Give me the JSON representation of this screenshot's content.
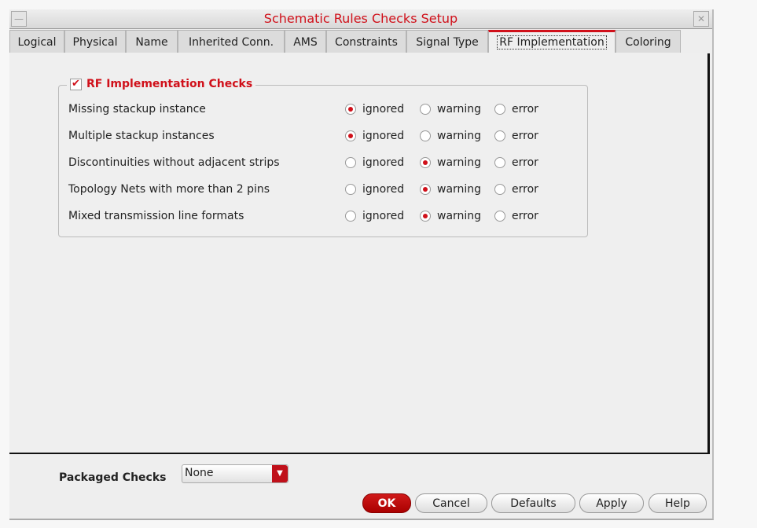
{
  "window": {
    "title": "Schematic Rules Checks Setup",
    "minimize_icon": "minimize-icon",
    "close_icon": "close-icon"
  },
  "tabs": [
    {
      "label": "Logical"
    },
    {
      "label": "Physical"
    },
    {
      "label": "Name"
    },
    {
      "label": "Inherited Conn."
    },
    {
      "label": "AMS"
    },
    {
      "label": "Constraints"
    },
    {
      "label": "Signal Type"
    },
    {
      "label": "RF Implementation",
      "active": true
    },
    {
      "label": "Coloring"
    }
  ],
  "group": {
    "label": "RF Implementation Checks",
    "checked": true
  },
  "options": [
    "ignored",
    "warning",
    "error"
  ],
  "checks": [
    {
      "label": "Missing stackup instance",
      "value": "ignored"
    },
    {
      "label": "Multiple stackup instances",
      "value": "ignored"
    },
    {
      "label": "Discontinuities without adjacent strips",
      "value": "warning"
    },
    {
      "label": "Topology Nets with more than 2 pins",
      "value": "warning"
    },
    {
      "label": "Mixed transmission line formats",
      "value": "warning"
    }
  ],
  "packaged": {
    "label": "Packaged Checks",
    "value": "None"
  },
  "buttons": {
    "ok": "OK",
    "cancel": "Cancel",
    "defaults": "Defaults",
    "apply": "Apply",
    "help": "Help"
  },
  "colors": {
    "accent": "#d0101a"
  }
}
